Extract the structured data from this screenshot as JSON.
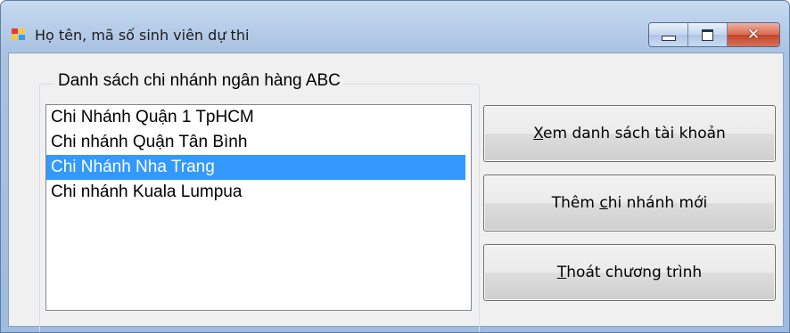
{
  "window": {
    "title": "Họ tên, mã số sinh viên dự thi",
    "controls": {
      "minimize": "minimize",
      "maximize": "maximize",
      "close": "close"
    }
  },
  "group": {
    "title": "Danh sách chi nhánh ngân hàng ABC",
    "items": [
      {
        "label": "Chi Nhánh Quận 1 TpHCM",
        "selected": false
      },
      {
        "label": "Chi nhánh Quận Tân Bình",
        "selected": false
      },
      {
        "label": "Chi Nhánh Nha Trang",
        "selected": true
      },
      {
        "label": "Chi nhánh Kuala Lumpua",
        "selected": false
      }
    ]
  },
  "buttons": {
    "view_accounts": {
      "mnemonic": "X",
      "rest": "em danh sách tài khoản"
    },
    "add_branch": {
      "before": "Thêm ",
      "mnemonic": "c",
      "rest": "hi nhánh mới"
    },
    "exit": {
      "mnemonic": "T",
      "rest": "hoát chương trình"
    }
  },
  "colors": {
    "selection": "#3399ff",
    "close_button": "#c4432b"
  }
}
